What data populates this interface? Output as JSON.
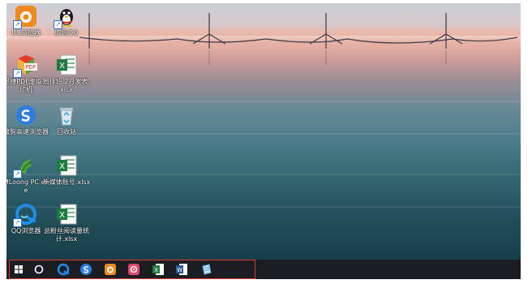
{
  "desktop": {
    "icons": [
      {
        "label": "UC浏览器",
        "icon": "uc-browser-icon"
      },
      {
        "label": "腾讯QQ",
        "icon": "qq-penguin-icon"
      },
      {
        "label": "迅捷PDF虚拟打印机",
        "icon": "pdf-printer-icon"
      },
      {
        "label": "周排班 2月发表.xlsx",
        "icon": "excel-file-icon"
      },
      {
        "label": "搜狗高速浏览器",
        "icon": "sogou-browser-icon"
      },
      {
        "label": "回收站",
        "icon": "recycle-bin-icon"
      },
      {
        "label": "MLoong PC.exe",
        "icon": "mloong-icon"
      },
      {
        "label": "新媒体账号.xlsx",
        "icon": "excel-file-icon"
      },
      {
        "label": "QQ浏览器",
        "icon": "qq-browser-icon"
      },
      {
        "label": "总粉丝阅读量统计.xlsx",
        "icon": "excel-file-icon"
      }
    ]
  },
  "taskbar": {
    "items": [
      {
        "name": "start-button",
        "icon": "windows-icon"
      },
      {
        "name": "search-button",
        "icon": "cortana-circle-icon"
      },
      {
        "name": "qq-browser",
        "icon": "qq-browser-icon"
      },
      {
        "name": "sogou-browser",
        "icon": "sogou-browser-icon"
      },
      {
        "name": "uc-browser",
        "icon": "uc-browser-icon"
      },
      {
        "name": "media-app",
        "icon": "media-app-icon"
      },
      {
        "name": "excel",
        "icon": "excel-icon"
      },
      {
        "name": "word",
        "icon": "word-icon"
      },
      {
        "name": "notepad",
        "icon": "notepad-icon"
      }
    ]
  },
  "colors": {
    "taskbar": "#1b1d22",
    "highlight_border": "#e0342e",
    "excel_green": "#1f7a3f",
    "word_blue": "#2b5797"
  }
}
